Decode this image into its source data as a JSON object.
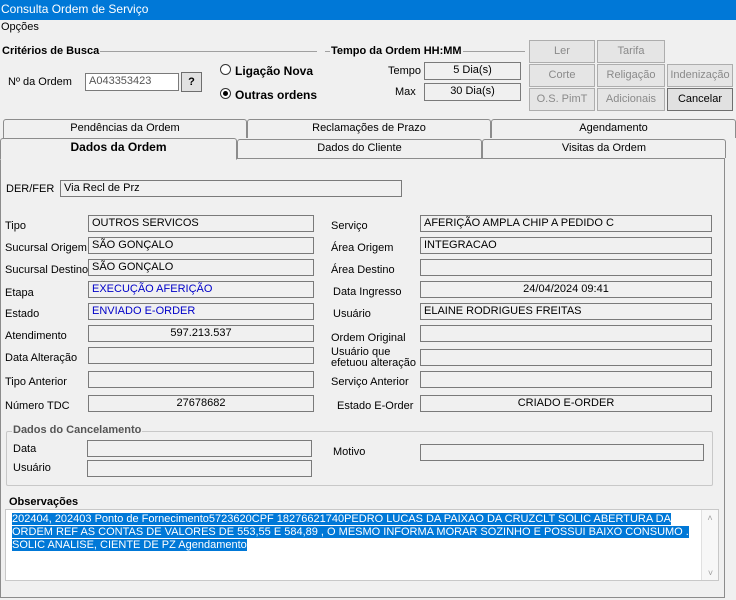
{
  "window": {
    "title": "Consulta Ordem de Serviço"
  },
  "menu": {
    "opcoes": "Opções"
  },
  "criterios": {
    "title": "Critérios de Busca",
    "order_label": "Nº da Ordem",
    "order_value": "A043353423",
    "help_label": "?",
    "radio_nova": "Ligação Nova",
    "radio_outras": "Outras ordens"
  },
  "tempo": {
    "title": "Tempo da Ordem HH:MM",
    "tempo_label": "Tempo",
    "tempo_value": "5 Dia(s)",
    "max_label": "Max",
    "max_value": "30 Dia(s)"
  },
  "buttons": {
    "ler": "Ler",
    "tarifa": "Tarifa",
    "corte": "Corte",
    "religacao": "Religação",
    "indenizacao": "Indenização",
    "os_pimt": "O.S. PimT",
    "adicionais": "Adicionais",
    "cancelar": "Cancelar"
  },
  "tabs": {
    "pendencias": "Pendências da Ordem",
    "reclamacoes": "Reclamações de Prazo",
    "agendamento": "Agendamento",
    "dados_ordem": "Dados da Ordem",
    "dados_cliente": "Dados do Cliente",
    "visitas": "Visitas da Ordem"
  },
  "form": {
    "der_fer_label": "DER/FER",
    "der_fer_value": "Via Recl de Prz",
    "tipo_label": "Tipo",
    "tipo_value": "OUTROS SERVICOS",
    "servico_label": "Serviço",
    "servico_value": "AFERIÇÃO AMPLA CHIP A PEDIDO C",
    "sucursal_origem_label": "Sucursal Origem",
    "sucursal_origem_value": "SÃO GONÇALO",
    "area_origem_label": "Área Origem",
    "area_origem_value": "INTEGRACAO",
    "sucursal_destino_label": "Sucursal Destino",
    "sucursal_destino_value": "SÃO GONÇALO",
    "area_destino_label": "Área Destino",
    "area_destino_value": "",
    "etapa_label": "Etapa",
    "etapa_value": "EXECUÇÃO AFERIÇÃO",
    "data_ingresso_label": "Data Ingresso",
    "data_ingresso_value": "24/04/2024 09:41",
    "estado_label": "Estado",
    "estado_value": "ENVIADO E-ORDER",
    "usuario_label": "Usuário",
    "usuario_value": "ELAINE RODRIGUES FREITAS",
    "atendimento_label": "Atendimento",
    "atendimento_value": "597.213.537",
    "ordem_original_label": "Ordem Original",
    "ordem_original_value": "",
    "data_alteracao_label": "Data Alteração",
    "data_alteracao_value": "",
    "usuario_alteracao_label_1": "Usuário que",
    "usuario_alteracao_label_2": "efetuou alteração",
    "usuario_alteracao_value": "",
    "tipo_anterior_label": "Tipo Anterior",
    "tipo_anterior_value": "",
    "servico_anterior_label": "Serviço Anterior",
    "servico_anterior_value": "",
    "numero_tdc_label": "Número TDC",
    "numero_tdc_value": "27678682",
    "estado_eorder_label": "Estado E-Order",
    "estado_eorder_value": "CRIADO E-ORDER"
  },
  "cancelamento": {
    "title": "Dados do Cancelamento",
    "data_label": "Data",
    "data_value": "",
    "usuario_label": "Usuário",
    "usuario_value": "",
    "motivo_label": "Motivo",
    "motivo_value": ""
  },
  "observacoes": {
    "title": "Observações",
    "line1": "202404, 202403   Ponto de Fornecimento5723620CPF  18276621740PEDRO LUCAS DA PAIXAO DA CRUZCLT SOLIC ABERTURA DA",
    "line2": "ORDEM REF AS CONTAS DE VALORES DE 553,55 E 584,89 , O MESMO INFORMA MORAR SOZINHO E POSSUI BAIXO CONSUMO .",
    "line3": "SOLIC ANALISE, CIENTE DE PZ Agendamento"
  },
  "colors": {
    "title_bar": "#0078d7",
    "selection": "#0078d7",
    "blue_text": "#0000c8"
  }
}
